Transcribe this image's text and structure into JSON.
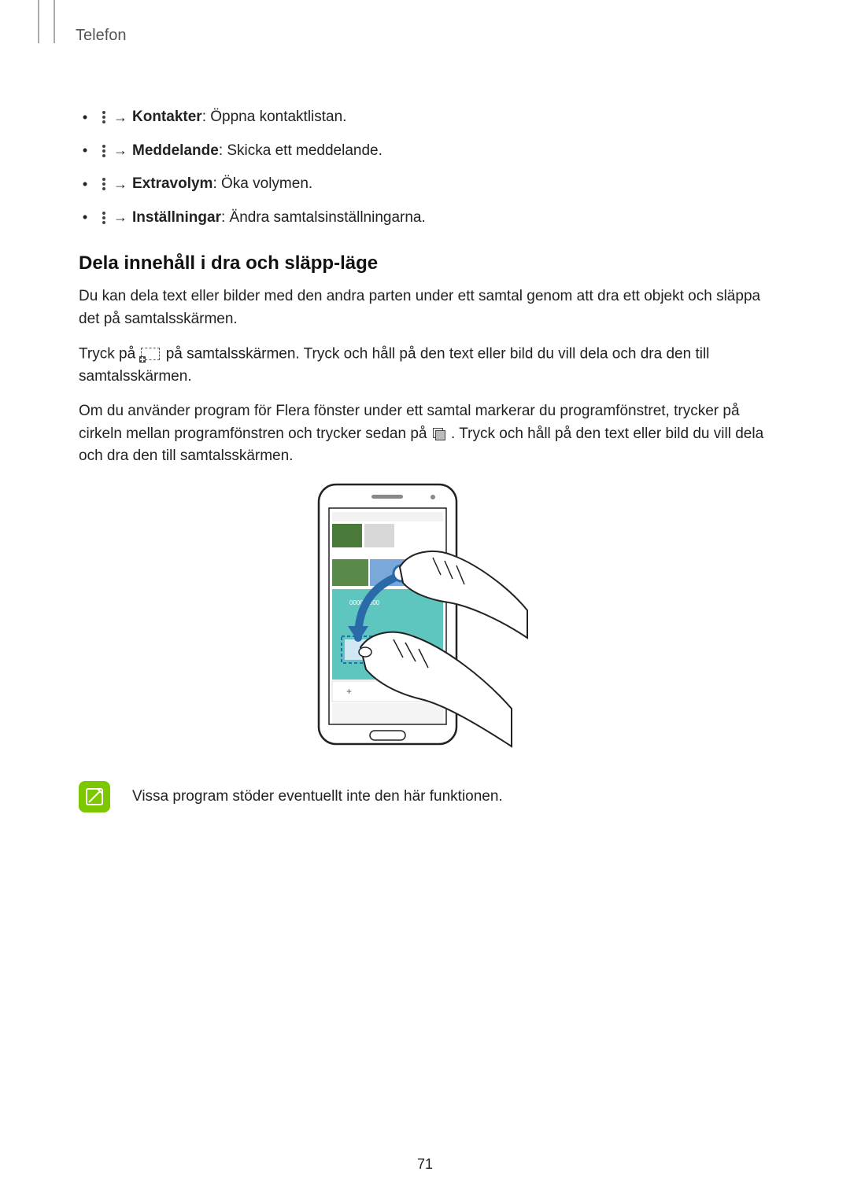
{
  "section_header": "Telefon",
  "menu": {
    "items": [
      {
        "label": "Kontakter",
        "desc": ": Öppna kontaktlistan."
      },
      {
        "label": "Meddelande",
        "desc": ": Skicka ett meddelande."
      },
      {
        "label": "Extravolym",
        "desc": ": Öka volymen."
      },
      {
        "label": "Inställningar",
        "desc": ": Ändra samtalsinställningarna."
      }
    ],
    "arrow": "→"
  },
  "subheading": "Dela innehåll i dra och släpp-läge",
  "paragraphs": {
    "p1": "Du kan dela text eller bilder med den andra parten under ett samtal genom att dra ett objekt och släppa det på samtalsskärmen.",
    "p2_pre": "Tryck på ",
    "p2_post": " på samtalsskärmen. Tryck och håll på den text eller bild du vill dela och dra den till samtalsskärmen.",
    "p3_pre": "Om du använder program för Flera fönster under ett samtal markerar du programfönstret, trycker på cirkeln mellan programfönstren och trycker sedan på ",
    "p3_post": ". Tryck och håll på den text eller bild du vill dela och dra den till samtalsskärmen."
  },
  "note_text": "Vissa program stöder eventuellt inte den här funktionen.",
  "page_number": "71"
}
